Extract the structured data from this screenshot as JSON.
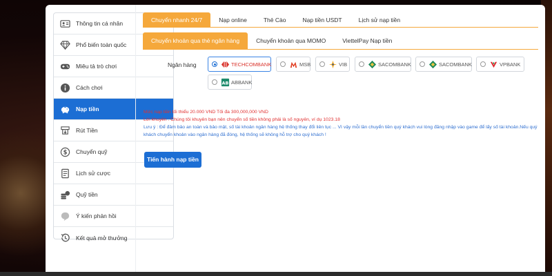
{
  "sidebar": {
    "items": [
      {
        "label": "Thông tin cá nhân",
        "icon": "user-card-icon"
      },
      {
        "label": "Phổ biến toàn quốc",
        "icon": "diamond-icon"
      },
      {
        "label": "Miêu tả trò chơi",
        "icon": "gamepad-icon"
      },
      {
        "label": "Cách chơi",
        "icon": "info-icon"
      },
      {
        "label": "Nạp tiền",
        "icon": "piggy-bank-icon",
        "active": true
      },
      {
        "label": "Rút Tiền",
        "icon": "withdraw-icon"
      },
      {
        "label": "Chuyển quỹ",
        "icon": "dollar-circle-icon"
      },
      {
        "label": "Lịch sử cược",
        "icon": "document-icon"
      },
      {
        "label": "Quỹ tiền",
        "icon": "coins-icon"
      },
      {
        "label": "Ý kiến phản hồi",
        "icon": "feedback-icon"
      },
      {
        "label": "Kết quả mở thưởng",
        "icon": "history-icon"
      }
    ]
  },
  "tabs_top": [
    {
      "label": "Chuyển nhanh 24/7",
      "active": true
    },
    {
      "label": "Nạp online"
    },
    {
      "label": "Thẻ Cào"
    },
    {
      "label": "Nạp tiền USDT"
    },
    {
      "label": "Lịch sử nạp tiền"
    }
  ],
  "tabs_sub": [
    {
      "label": "Chuyển khoản qua thẻ ngân hàng",
      "active": true
    },
    {
      "label": "Chuyển khoản qua MOMO"
    },
    {
      "label": "ViettelPay Nạp tiền"
    }
  ],
  "bank_label": "Ngân hàng",
  "banks": [
    {
      "name": "TECHCOMBANK",
      "selected": true,
      "logo": "techcombank-logo-icon",
      "color": "#d9332b"
    },
    {
      "name": "MSB",
      "logo": "msb-logo-icon",
      "color": "#e03a1e"
    },
    {
      "name": "VIB",
      "logo": "vib-logo-icon",
      "color": "#f2a516"
    },
    {
      "name": "SACOMBANK",
      "logo": "sacombank-logo-icon",
      "color": "#1f8a5a"
    },
    {
      "name": "SACOMBANK",
      "logo": "sacombank-logo-icon",
      "color": "#1f8a5a"
    },
    {
      "name": "VPBANK",
      "logo": "vpbank-logo-icon",
      "color": "#e0282f"
    },
    {
      "name": "ABBANK",
      "logo": "abbank-logo-icon",
      "color": "#1c8a6b"
    }
  ],
  "notes": {
    "limit": "Mức nạp tiền tối thiểu 20.000 VND Tối đa 300,000,000 VND",
    "promo": "Lời khuyên : Chúng tôi khuyên bạn nên chuyển số tiền không phải là số nguyên, ví dụ 1023.18",
    "warning": "Lưu ý : Để đảm bảo an toàn và bảo mật, số tài khoản ngân hàng hệ thống thay đổi liên tục ... Vì vậy mỗi lần chuyển tiền quý khách vui lòng đăng nhập vào game để lấy số tài khoản.Nếu quý khách chuyển khoản vào ngân hàng đã đóng, hệ thống sẽ không hỗ trợ cho quý khách !"
  },
  "submit_label": "Tiến hành nạp tiền",
  "colors": {
    "accent": "#f5a83b",
    "primary": "#1c6ed4",
    "note_red": "#e03030",
    "note_blue": "#2f6fd0"
  }
}
